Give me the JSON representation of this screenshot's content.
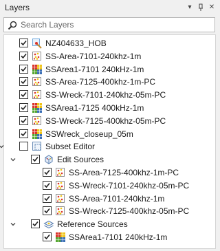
{
  "panel": {
    "title": "Layers"
  },
  "search": {
    "placeholder": "Search Layers"
  },
  "colors": {
    "accent": "#2b8bd6",
    "hob": "#6fa8dc",
    "grid_red": "#d9342b",
    "grid_yellow": "#f0c419",
    "grid_green": "#55a630",
    "grid_blue": "#3b6fb6"
  },
  "layers": [
    {
      "label": "NZ404633_HOB",
      "icon": "hob-icon",
      "checked": true
    },
    {
      "label": "SS-Area-7101-240khz-1m",
      "icon": "point-cloud-icon",
      "checked": true
    },
    {
      "label": "SSArea1-7101 240kHz-1m",
      "icon": "raster-grid-icon",
      "checked": true
    },
    {
      "label": "SS-Area-7125-400khz-1m-PC",
      "icon": "point-cloud-icon",
      "checked": true
    },
    {
      "label": "SS-Wreck-7101-240khz-05m-PC",
      "icon": "point-cloud-icon",
      "checked": true
    },
    {
      "label": "SSArea1-7125 400kHz-1m",
      "icon": "raster-grid-icon",
      "checked": true
    },
    {
      "label": "SS-Wreck-7125-400khz-05m-PC",
      "icon": "point-cloud-icon",
      "checked": true
    },
    {
      "label": "SSWreck_closeup_05m",
      "icon": "raster-grid-icon",
      "checked": true
    }
  ],
  "subset_editor": {
    "label": "Subset Editor",
    "checked": true,
    "edit_sources": {
      "label": "Edit Sources",
      "items": [
        "SS-Area-7125-400khz-1m-PC",
        "SS-Wreck-7101-240khz-05m-PC",
        "SS-Area-7101-240khz-1m",
        "SS-Wreck-7125-400khz-05m-PC"
      ]
    },
    "reference_sources": {
      "label": "Reference Sources",
      "items": [
        "SSArea1-7101 240kHz-1m"
      ]
    }
  }
}
